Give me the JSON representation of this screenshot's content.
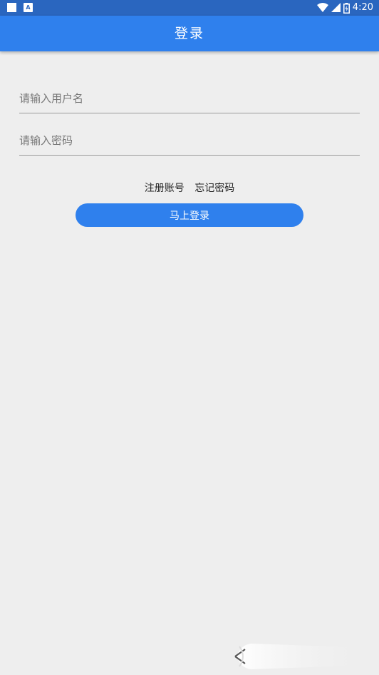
{
  "status_bar": {
    "time": "4:20",
    "icons": [
      "notification-square-icon",
      "text-a-icon",
      "wifi-icon",
      "signal-icon",
      "battery-icon"
    ]
  },
  "app_bar": {
    "title": "登录"
  },
  "form": {
    "username_placeholder": "请输入用户名",
    "username_value": "",
    "password_placeholder": "请输入密码",
    "password_value": ""
  },
  "links": {
    "register": "注册账号",
    "forgot_password": "忘记密码"
  },
  "login_button": {
    "label": "马上登录"
  },
  "colors": {
    "primary": "#2f80ed",
    "status_bar": "#2a66bf",
    "background": "#eeeeee"
  }
}
